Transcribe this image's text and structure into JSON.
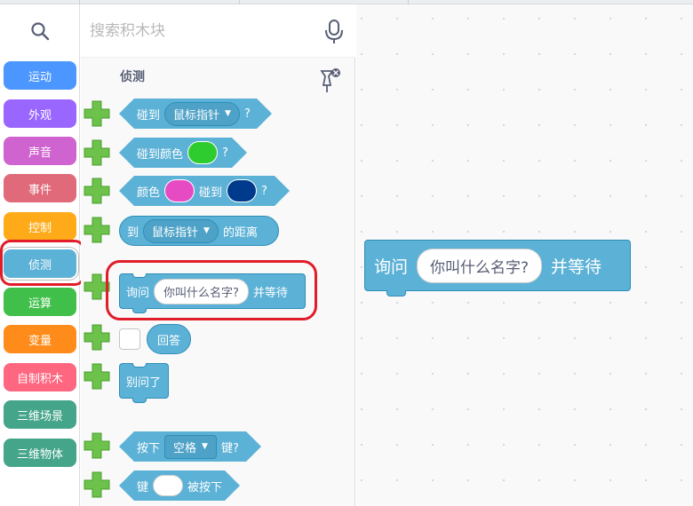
{
  "search": {
    "placeholder": "搜索积木块"
  },
  "categories": [
    {
      "label": "运动",
      "color": "#4c97ff"
    },
    {
      "label": "外观",
      "color": "#9966ff"
    },
    {
      "label": "声音",
      "color": "#cf63cf"
    },
    {
      "label": "事件",
      "color": "#e06a79"
    },
    {
      "label": "控制",
      "color": "#ffab19"
    },
    {
      "label": "侦测",
      "color": "#5cb1d6",
      "selected": true
    },
    {
      "label": "运算",
      "color": "#40bf4a"
    },
    {
      "label": "变量",
      "color": "#ff8c1a"
    },
    {
      "label": "自制积木",
      "color": "#ff6680"
    },
    {
      "label": "三维场景",
      "color": "#45a58a"
    },
    {
      "label": "三维物体",
      "color": "#45a58a"
    }
  ],
  "flyout": {
    "section_title": "侦测",
    "blocks": {
      "touching": {
        "prefix": "碰到",
        "dropdown": "鼠标指针",
        "suffix": "?"
      },
      "touching_color": {
        "prefix": "碰到颜色",
        "suffix": "?",
        "color": "#2ecc2e"
      },
      "color_touching": {
        "prefix": "颜色",
        "mid": "碰到",
        "suffix": "?",
        "color1": "#e64bc4",
        "color2": "#003a8c"
      },
      "distance_to": {
        "prefix": "到",
        "dropdown": "鼠标指针",
        "suffix": "的距离"
      },
      "ask": {
        "prefix": "询问",
        "input": "你叫什么名字?",
        "suffix": "并等待"
      },
      "answer": {
        "label": "回答"
      },
      "dont_ask": {
        "label": "别问了"
      },
      "key_pressed": {
        "prefix": "按下",
        "dropdown": "空格",
        "suffix": "键?"
      },
      "key_is_pressed": {
        "prefix": "键",
        "suffix": "被按下"
      }
    }
  },
  "workspace": {
    "ask_block": {
      "prefix": "询问",
      "input": "你叫什么名字?",
      "suffix": "并等待"
    }
  },
  "colors": {
    "sensing": "#5cb1d6",
    "highlight": "#e01d28",
    "plus": "#6cc24a"
  }
}
